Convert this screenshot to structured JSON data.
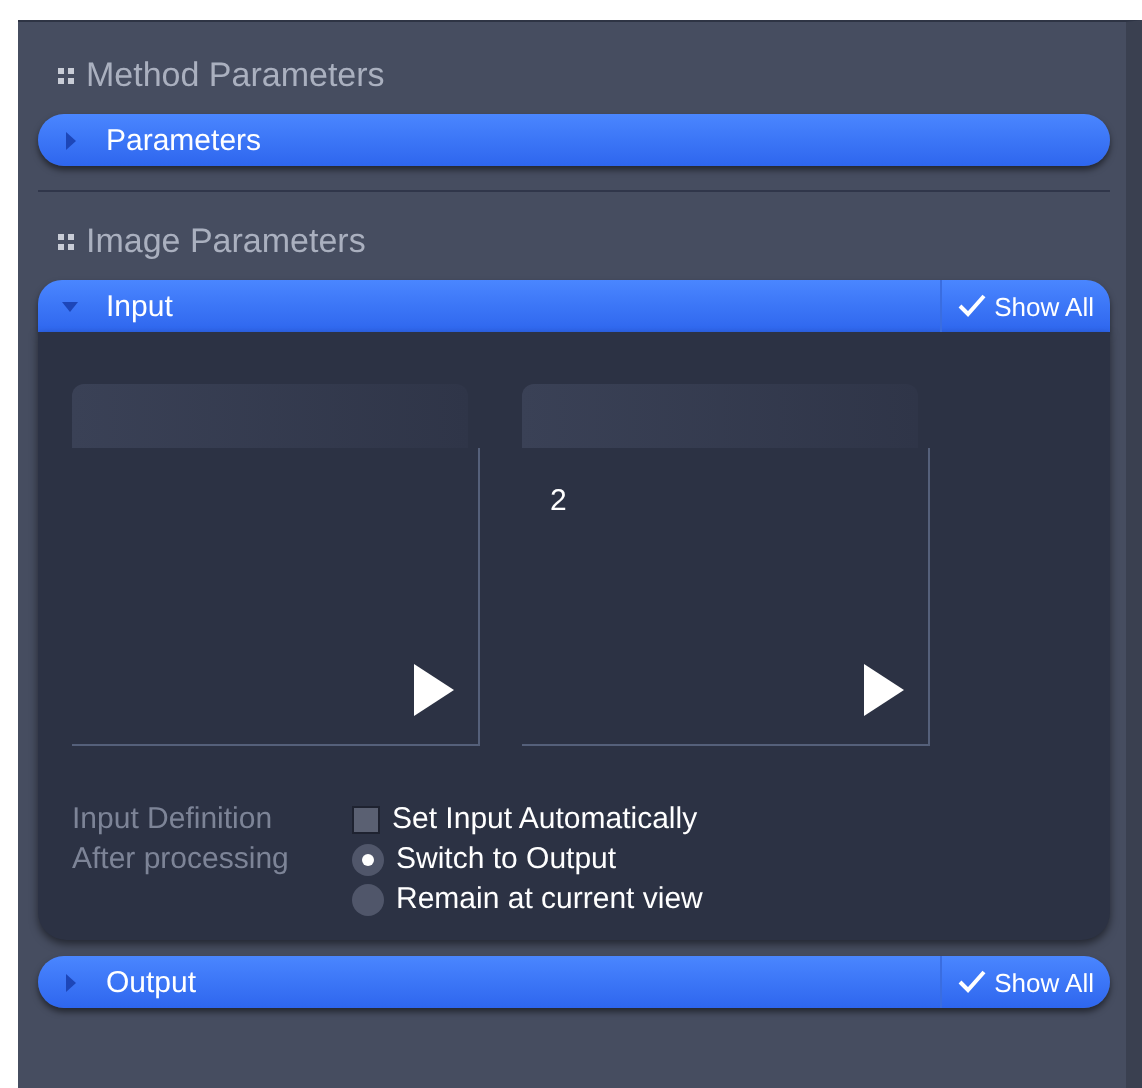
{
  "sections": [
    {
      "title": "Method Parameters",
      "groups": [
        {
          "label": "Parameters",
          "expanded": false
        }
      ]
    },
    {
      "title": "Image Parameters",
      "groups": [
        {
          "label": "Input",
          "expanded": true,
          "show_all": {
            "label": "Show All",
            "checked": true
          },
          "slots": [
            {
              "kind": "empty"
            },
            {
              "kind": "numbered",
              "number": "2"
            }
          ],
          "input_definition": {
            "label": "Input Definition",
            "checkbox": {
              "label": "Set Input Automatically",
              "checked": false
            }
          },
          "after_processing": {
            "label": "After processing",
            "options": [
              {
                "label": "Switch to Output",
                "selected": true
              },
              {
                "label": "Remain at current view",
                "selected": false
              }
            ]
          }
        },
        {
          "label": "Output",
          "expanded": false,
          "show_all": {
            "label": "Show All",
            "checked": true
          }
        }
      ]
    }
  ]
}
